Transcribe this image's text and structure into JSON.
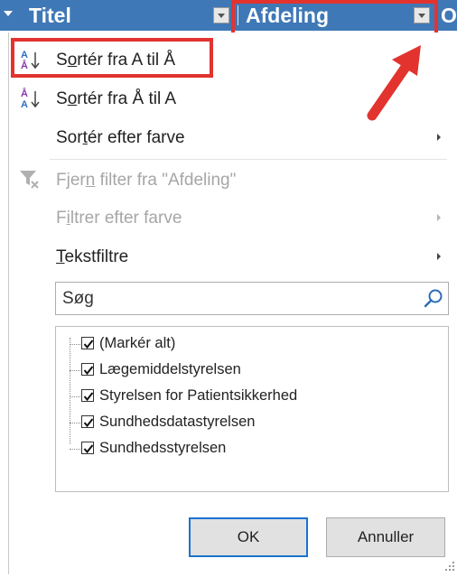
{
  "header": {
    "col1_title": "Titel",
    "col2_title": "Afdeling",
    "col3_partial": "O"
  },
  "menu": {
    "sort_az": {
      "prefix": "S",
      "accel": "o",
      "rest": "rtér fra A til Å"
    },
    "sort_za": {
      "prefix": "S",
      "accel": "o",
      "rest": "rtér fra Å til A"
    },
    "sort_color": {
      "prefix": "Sor",
      "accel": "t",
      "rest": "ér efter farve"
    },
    "clear_filter": {
      "prefix": "Fjer",
      "accel": "n",
      "rest": " filter fra \"Afdeling\""
    },
    "filter_color": {
      "prefix": "F",
      "accel": "i",
      "rest": "ltrer efter farve"
    },
    "text_filters": {
      "prefix": "",
      "accel": "T",
      "rest": "ekstfiltre"
    }
  },
  "search": {
    "placeholder": "Søg"
  },
  "filter_list": {
    "items": [
      {
        "label": "(Markér alt)",
        "checked": true
      },
      {
        "label": "Lægemiddelstyrelsen",
        "checked": true
      },
      {
        "label": "Styrelsen for Patientsikkerhed",
        "checked": true
      },
      {
        "label": "Sundhedsdatastyrelsen",
        "checked": true
      },
      {
        "label": "Sundhedsstyrelsen",
        "checked": true
      }
    ]
  },
  "buttons": {
    "ok": "OK",
    "cancel": "Annuller"
  },
  "colors": {
    "header_bg": "#3f78b6",
    "highlight_red": "#e2332f",
    "accent_blue": "#1a73d0"
  },
  "icons": {
    "sort_az": "sort-a-z-icon",
    "sort_za": "sort-z-a-icon",
    "clear_filter": "clear-filter-icon",
    "search": "magnifier-icon"
  }
}
